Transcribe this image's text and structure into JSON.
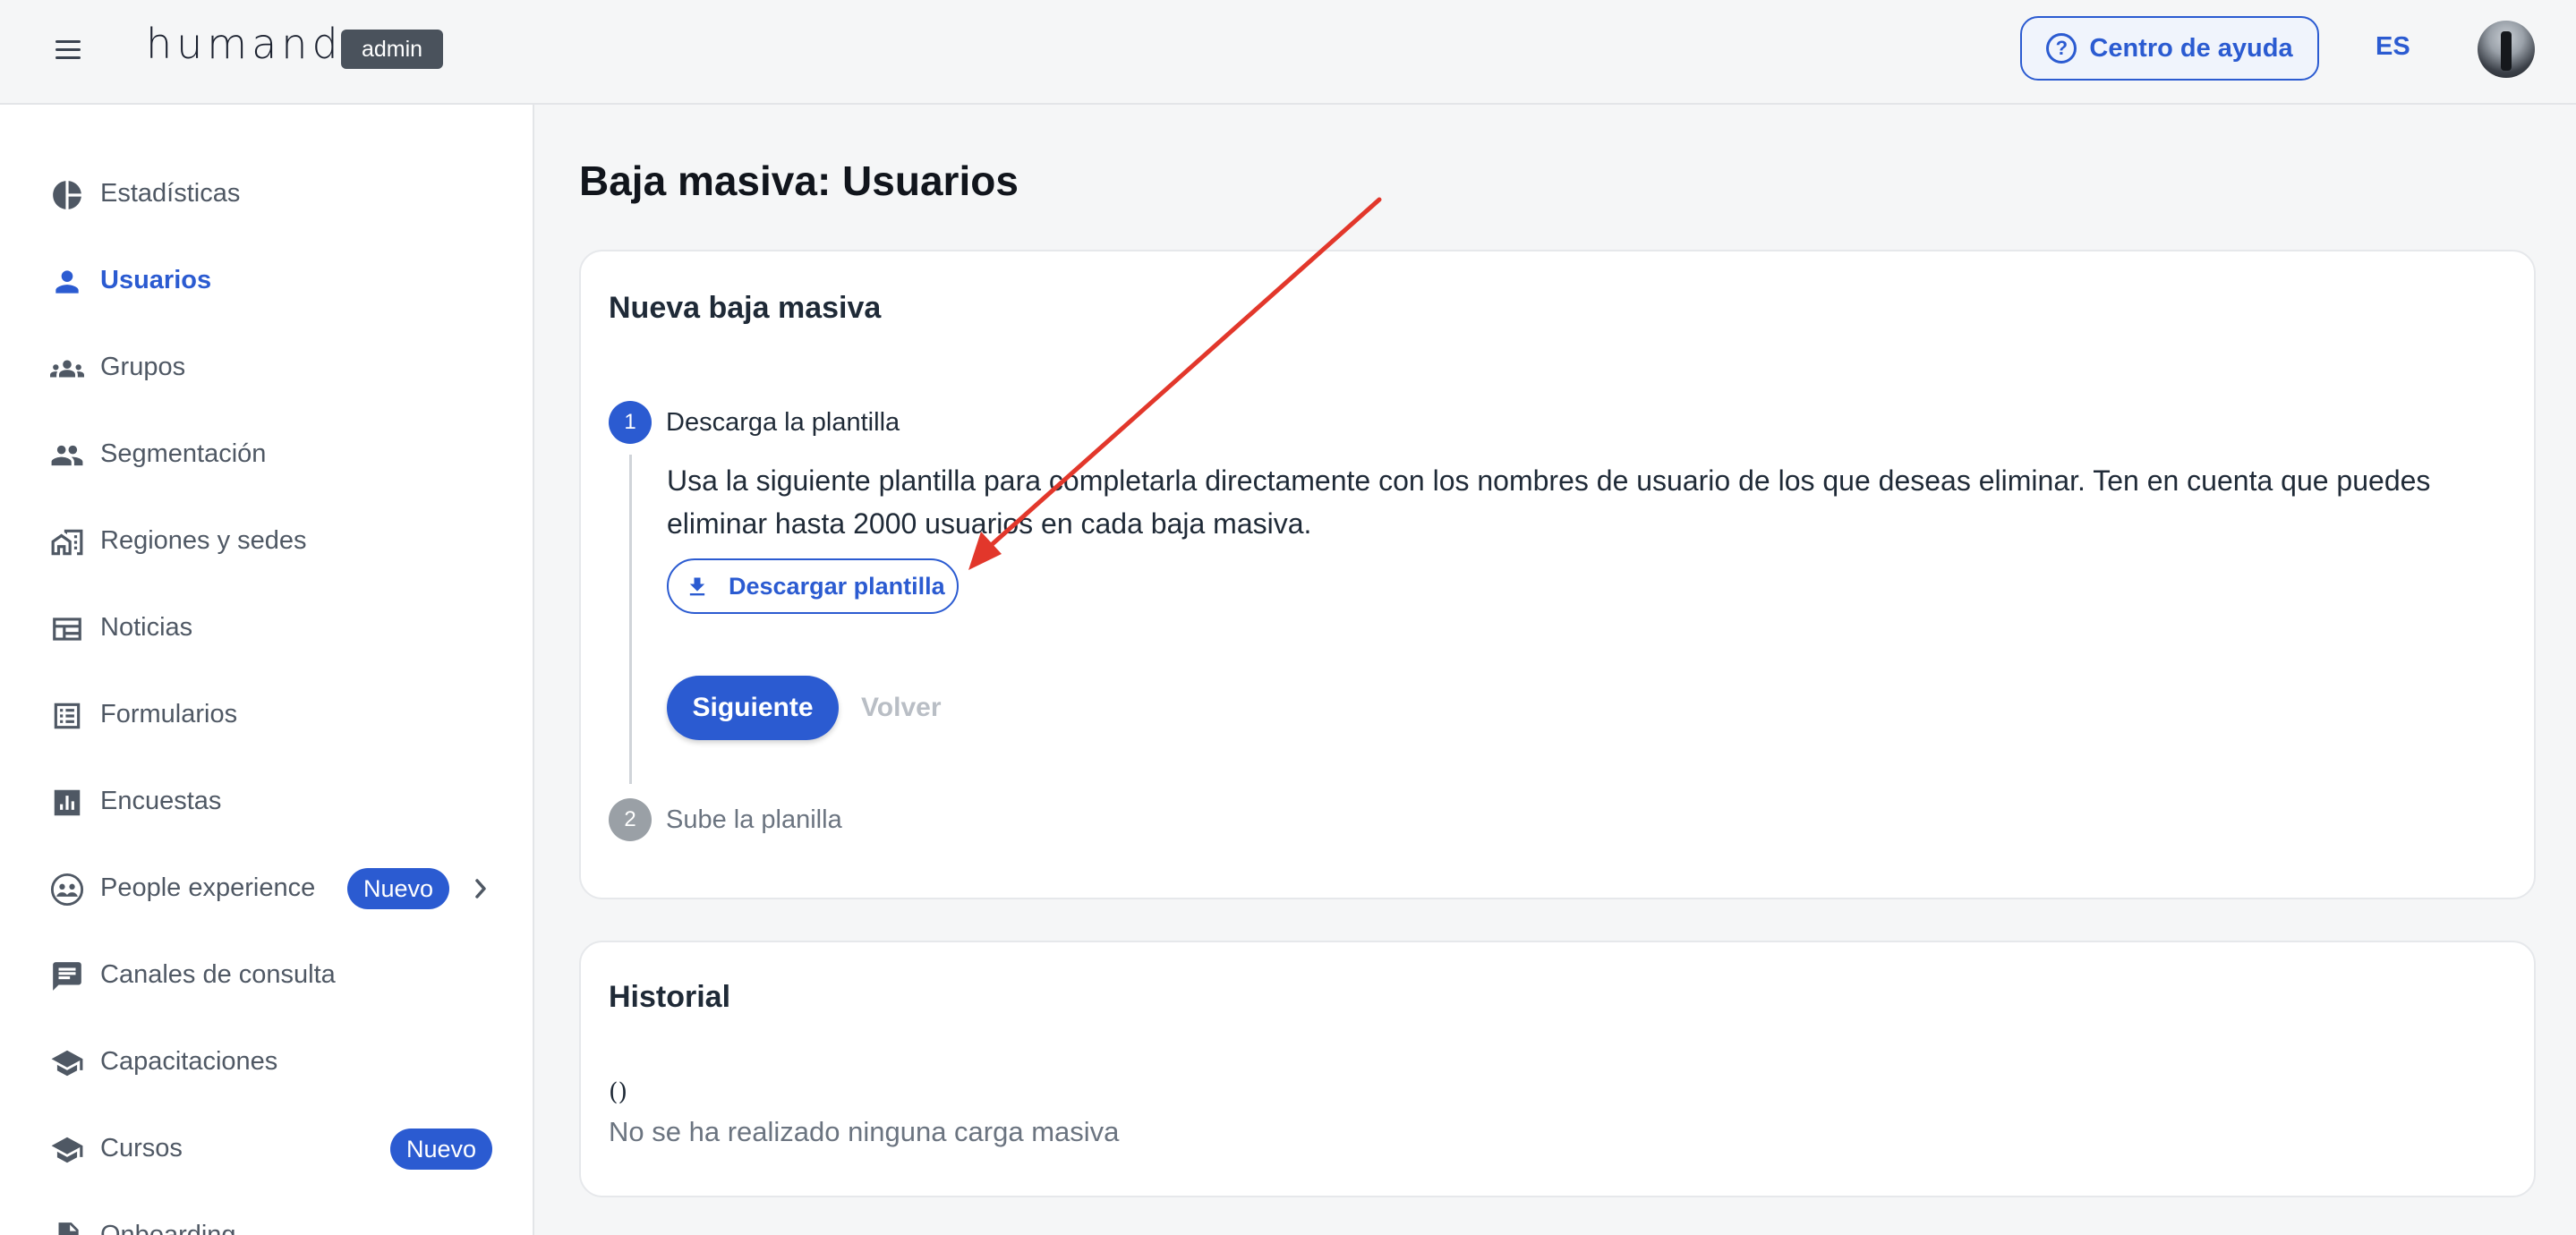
{
  "header": {
    "logo": "humand",
    "admin_badge": "admin",
    "help_label": "Centro de ayuda",
    "help_icon": "?",
    "language": "ES"
  },
  "sidebar": {
    "items": [
      {
        "label": "Estadísticas",
        "icon": "pie-chart-icon"
      },
      {
        "label": "Usuarios",
        "icon": "person-icon",
        "active": true
      },
      {
        "label": "Grupos",
        "icon": "groups-icon"
      },
      {
        "label": "Segmentación",
        "icon": "people-icon"
      },
      {
        "label": "Regiones y sedes",
        "icon": "buildings-icon"
      },
      {
        "label": "Noticias",
        "icon": "newspaper-icon"
      },
      {
        "label": "Formularios",
        "icon": "list-form-icon"
      },
      {
        "label": "Encuestas",
        "icon": "bar-chart-icon"
      },
      {
        "label": "People experience",
        "icon": "people-circle-icon",
        "badge": "Nuevo"
      },
      {
        "label": "Canales de consulta",
        "icon": "chat-icon"
      },
      {
        "label": "Capacitaciones",
        "icon": "graduation-cap-icon"
      },
      {
        "label": "Cursos",
        "icon": "graduation-cap-icon",
        "badge": "Nuevo"
      },
      {
        "label": "Onboarding",
        "icon": "document-icon"
      }
    ]
  },
  "main": {
    "title": "Baja masiva: Usuarios",
    "wizard": {
      "title": "Nueva baja masiva",
      "step1": {
        "number": "1",
        "title": "Descarga la plantilla",
        "description": "Usa la siguiente plantilla para completarla directamente con los nombres de usuario de los que deseas eliminar. Ten en cuenta que puedes eliminar hasta 2000 usuarios en cada baja masiva.",
        "download_label": "Descargar plantilla",
        "next_label": "Siguiente",
        "back_label": "Volver"
      },
      "step2": {
        "number": "2",
        "title": "Sube la planilla"
      }
    },
    "history": {
      "title": "Historial",
      "count": "()",
      "empty_text": "No se ha realizado ninguna carga masiva"
    }
  },
  "colors": {
    "accent": "#2b5bd1",
    "annotation_arrow": "#e2372b",
    "muted": "#9aa0a6"
  }
}
